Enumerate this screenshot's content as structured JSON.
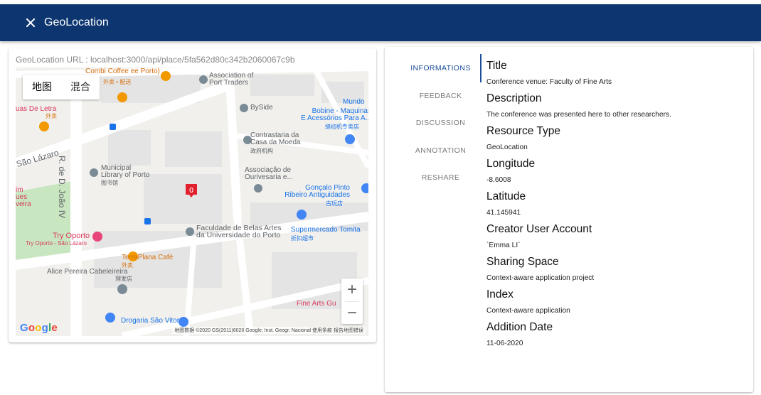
{
  "header": {
    "title": "GeoLocation"
  },
  "map": {
    "url_label": "GeoLocation URL : localhost:3000/api/place/5fa562d80c342b2060067c9b",
    "map_types": [
      "地图",
      "混合"
    ],
    "zoom_in": "+",
    "zoom_out": "−",
    "google_logo": "Google",
    "footer": "地图数据 ©2020 GS(2011)6020 Google, Inst. Geogr. Nacional   使用条款   报告地图错误",
    "pois": {
      "combi": "Combi Coffee\nee Porto)",
      "combi_sub": "外卖 • 配送",
      "association": "Association of\nPort Traders",
      "byside": "BySide",
      "mundo": "Mundo",
      "bobine": "Bobine - Maquinas\nE Acessórios Para A...",
      "bobine_sub": "缝纫机专卖店",
      "contrastaria": "Contrastaria da\nCasa da Moeda",
      "contrastaria_sub": "政府机构",
      "luas": "uas De Letra",
      "luas_sub": "外卖",
      "rua_joao": "R. de D. João IV",
      "sao_lazaro": "São Lázaro",
      "library": "Municipal\nLibrary of Porto",
      "library_sub": "图书馆",
      "associacao": "Associação de\nOurivesaria e...",
      "goncalo": "Gonçalo Pinto\nRibeiro Antiguidades",
      "goncalo_sub": "古玩店",
      "jardim": "im\nues\nveira",
      "faculdade": "Faculdade de Belas Artes\nda Universidade do Porto",
      "supermercado": "Supermercado Tomita",
      "supermercado_sub": "折扣超市",
      "try_oporto": "Try Oporto",
      "try_oporto_sub": "Try Oporto - São Lázaro",
      "terraplana": "TerraPlana Café",
      "terraplana_sub": "外卖",
      "alice": "Alice Pereira Cabeleireira",
      "alice_sub": "理发店",
      "fine_arts": "Fine Arts Gu",
      "drogaria": "Drogaria São Vitor"
    },
    "marker_label": "0",
    "colors": {
      "park": "#c8e6c0",
      "road": "#ffffff",
      "block": "#e8e8e8",
      "marker": "#e0202d"
    }
  },
  "tabs": [
    "INFORMATIONS",
    "FEEDBACK",
    "DISCUSSION",
    "ANNOTATION",
    "RESHARE"
  ],
  "fields": [
    {
      "label": "Title",
      "value": "Conference venue: Faculty of Fine Arts"
    },
    {
      "label": "Description",
      "value": "The conference was presented here to other researchers."
    },
    {
      "label": "Resource Type",
      "value": "GeoLocation"
    },
    {
      "label": "Longitude",
      "value": "-8.6008"
    },
    {
      "label": "Latitude",
      "value": "41.145941"
    },
    {
      "label": "Creator User Account",
      "value": "`Emma LI`"
    },
    {
      "label": "Sharing Space",
      "value": "Context-aware application project"
    },
    {
      "label": "Index",
      "value": "Context-aware application"
    },
    {
      "label": "Addition Date",
      "value": "11-06-2020"
    }
  ]
}
